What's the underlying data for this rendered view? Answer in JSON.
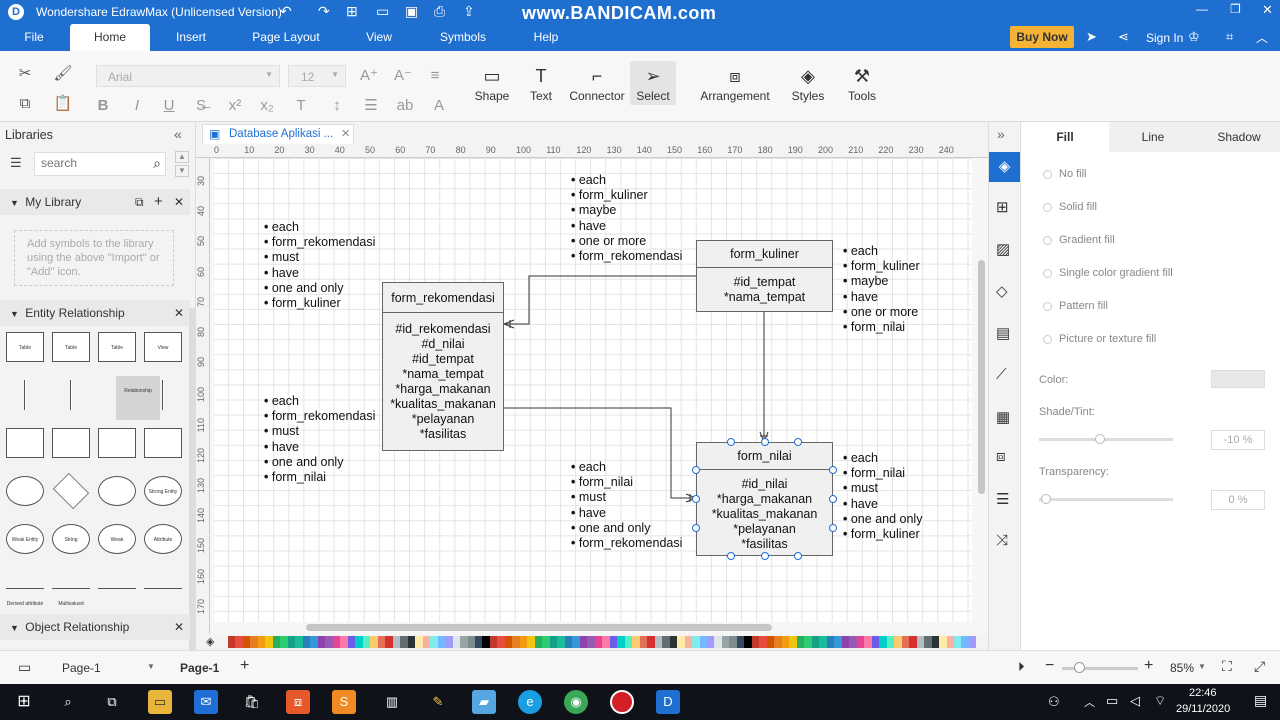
{
  "title_bar": {
    "title": "Wondershare EdrawMax (Unlicensed Version)",
    "watermark": "www.BANDICAM.com",
    "buy_now": "Buy Now",
    "sign_in": "Sign In"
  },
  "menu": [
    "File",
    "Home",
    "Insert",
    "Page Layout",
    "View",
    "Symbols",
    "Help"
  ],
  "ribbon": {
    "font_name": "Arial",
    "font_size": "12",
    "tools": [
      "Shape",
      "Text",
      "Connector",
      "Select",
      "Arrangement",
      "Styles",
      "Tools"
    ]
  },
  "libraries": {
    "title": "Libraries",
    "search_placeholder": "search",
    "my_library": "My Library",
    "my_library_hint": "Add symbols to the library using the above \"Import\" or \"Add\" icon.",
    "entity_relationship": "Entity Relationship",
    "object_relationship": "Object Relationship",
    "shapes": [
      "Table",
      "Table",
      "Table",
      "View",
      "",
      "",
      "Relationship",
      "",
      "",
      "",
      "",
      "",
      "",
      "",
      "",
      "Strong Entity",
      "Weak Entity",
      "String",
      "Weak",
      "Attribute",
      "Derived attribute",
      "Multivalued attribute",
      "",
      ""
    ]
  },
  "doc_tab": "Database Aplikasi ...",
  "ruler_top": [
    "0",
    "10",
    "20",
    "30",
    "40",
    "50",
    "60",
    "70",
    "80",
    "90",
    "100",
    "110",
    "120",
    "130",
    "140",
    "150",
    "160",
    "170",
    "180",
    "190",
    "200",
    "210",
    "220",
    "230",
    "240"
  ],
  "ruler_left": [
    "30",
    "40",
    "50",
    "60",
    "70",
    "80",
    "90",
    "100",
    "110",
    "120",
    "130",
    "140",
    "150",
    "160",
    "170"
  ],
  "diagram": {
    "entities": [
      {
        "name": "form_rekomendasi",
        "attrs": [
          "#id_rekomendasi",
          "#d_nilai",
          "#id_tempat",
          "*nama_tempat",
          "*harga_makanan",
          "*kualitas_makanan",
          "*pelayanan",
          "*fasilitas"
        ]
      },
      {
        "name": "form_kuliner",
        "attrs": [
          "#id_tempat",
          "*nama_tempat"
        ]
      },
      {
        "name": "form_nilai",
        "attrs": [
          "#id_nilai",
          "*harga_makanan",
          "*kualitas_makanan",
          "*pelayanan",
          "*fasilitas"
        ]
      }
    ],
    "notes": [
      [
        "each",
        "form_rekomendasi",
        "must",
        "have",
        "one and only",
        "form_kuliner"
      ],
      [
        "each",
        "form_rekomendasi",
        "must",
        "have",
        "one and only",
        "form_nilai"
      ],
      [
        "each",
        "form_kuliner",
        "maybe",
        "have",
        "one or more",
        "form_rekomendasi"
      ],
      [
        "each",
        "form_kuliner",
        "maybe",
        "have",
        "one or more",
        "form_nilai"
      ],
      [
        "each",
        "form_nilai",
        "must",
        "have",
        "one and only",
        "form_rekomendasi"
      ],
      [
        "each",
        "form_nilai",
        "must",
        "have",
        "one and only",
        "form_kuliner"
      ]
    ]
  },
  "right_panel": {
    "tabs": [
      "Fill",
      "Line",
      "Shadow"
    ],
    "fill_options": [
      "No fill",
      "Solid fill",
      "Gradient fill",
      "Single color gradient fill",
      "Pattern fill",
      "Picture or texture fill"
    ],
    "color_label": "Color:",
    "shade_label": "Shade/Tint:",
    "shade_value": "-10 %",
    "transparency_label": "Transparency:",
    "transparency_value": "0 %"
  },
  "status": {
    "page_select": "Page-1",
    "page_tab": "Page-1",
    "zoom": "85%"
  },
  "taskbar": {
    "time": "22:46",
    "date": "29/11/2020"
  },
  "colors": {
    "accent": "#1f6fd0",
    "buy": "#f5b335"
  }
}
